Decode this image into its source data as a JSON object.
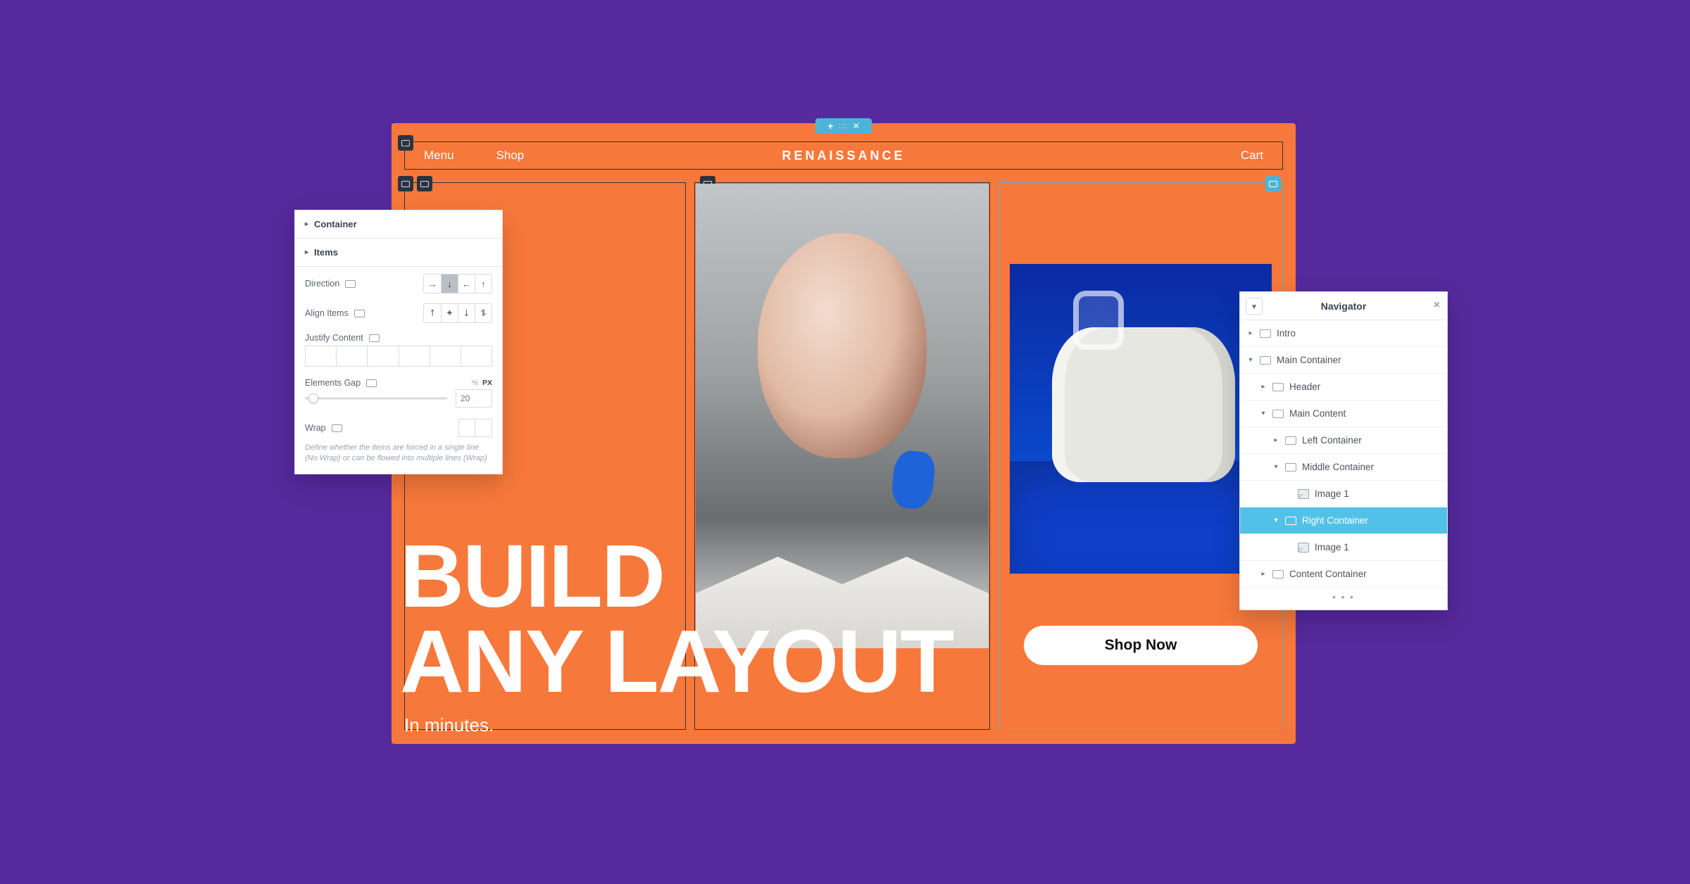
{
  "header": {
    "menu": "Menu",
    "shop": "Shop",
    "brand": "RENAISSANCE",
    "cart": "Cart"
  },
  "headline": {
    "line1": "BUILD",
    "line2": "ANY LAYOUT",
    "sub": "In minutes."
  },
  "shop_button": "Shop Now",
  "props": {
    "container": "Container",
    "items": "Items",
    "direction": "Direction",
    "align": "Align Items",
    "justify": "Justify Content",
    "gap": "Elements Gap",
    "gap_val": "20",
    "unit_pct": "%",
    "unit_px": "PX",
    "wrap": "Wrap",
    "hint1": "Define whether the items are forced in a single line",
    "hint2": "(No Wrap) or can be flowed into multiple lines (Wrap)"
  },
  "navigator": {
    "title": "Navigator",
    "tree": {
      "intro": "Intro",
      "main": "Main Container",
      "header": "Header",
      "content": "Main Content",
      "left": "Left Container",
      "middle": "Middle Container",
      "img1a": "Image 1",
      "right": "Right Container",
      "img1b": "Image 1",
      "contentc": "Content Container"
    }
  }
}
